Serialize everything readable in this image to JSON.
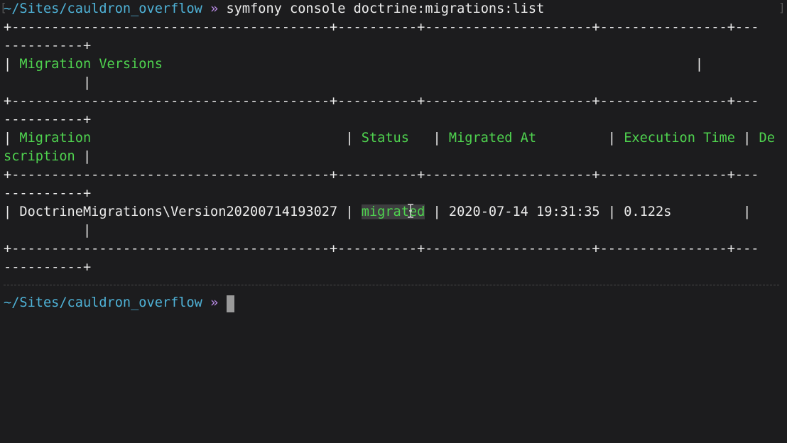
{
  "prompt": {
    "path": "~/Sites/cauldron_overflow",
    "symbol": "»",
    "command": "symfony console doctrine:migrations:list"
  },
  "table": {
    "border_row_a": "+----------------------------------------+----------+---------------------+----------------+---",
    "border_row_b": "----------+",
    "title_prefix": "| ",
    "title": "Migration Versions",
    "title_suffix": "                                                                   |",
    "title_wrap": "          |",
    "headers": {
      "migration": "Migration",
      "status": "Status",
      "migrated_at": "Migrated At",
      "execution_time": "Execution Time",
      "description_start": "De",
      "description_end": "scription"
    },
    "row": {
      "migration": "DoctrineMigrations\\Version20200714193027",
      "status": "migrated",
      "migrated_at": "2020-07-14 19:31:35",
      "execution_time": "0.122s"
    }
  },
  "colors": {
    "background": "#1c1c1e",
    "path": "#4fb3d8",
    "prompt_symbol": "#b98be6",
    "header_text": "#4fd34f",
    "body_text": "#ececec"
  }
}
